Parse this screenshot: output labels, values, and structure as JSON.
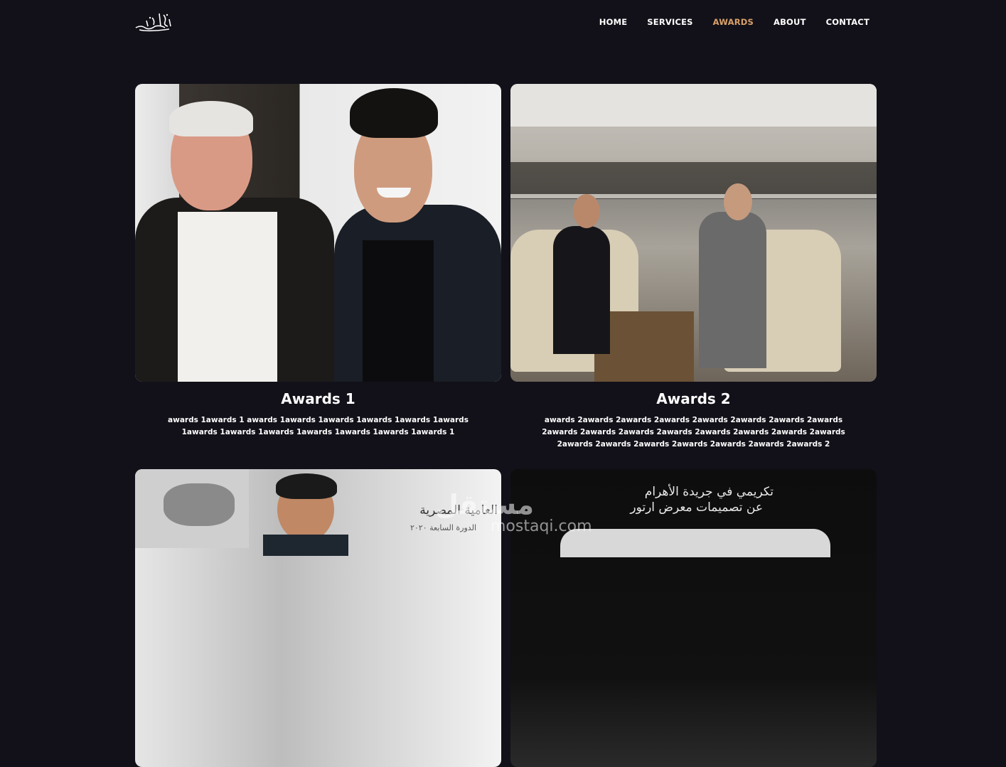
{
  "nav": {
    "items": [
      {
        "label": "HOME",
        "active": false
      },
      {
        "label": "SERVICES",
        "active": false
      },
      {
        "label": "AWARDS",
        "active": true
      },
      {
        "label": "ABOUT",
        "active": false
      },
      {
        "label": "CONTACT",
        "active": false
      }
    ],
    "active_color": "#d9a16a"
  },
  "awards": [
    {
      "title": "Awards 1",
      "desc": "awards 1awards 1 awards 1awards 1awards 1awards 1awards 1awards 1awards 1awards 1awards 1awards 1awards 1awards 1awards 1"
    },
    {
      "title": "Awards 2",
      "desc": "awards 2awards 2awards 2awards 2awards 2awards 2awards 2awards 2awards 2awards 2awards 2awards 2awards 2awards 2awards 2awards 2awards 2awards 2awards 2awards 2awards 2awards 2awards 2"
    }
  ],
  "photo3": {
    "arabic_title": "العامية المصرية",
    "arabic_sub": "الدورة السابعة ٢٠٢٠"
  },
  "photo4": {
    "arabic_line1": "تكريمي في جريدة الأهرام",
    "arabic_line2": "عن تصميمات معرض ارتور"
  },
  "watermark": {
    "text": "مستقل",
    "url": "mostaqi.com"
  },
  "colors": {
    "background": "#121119",
    "text": "#ffffff",
    "accent": "#d9a16a"
  }
}
